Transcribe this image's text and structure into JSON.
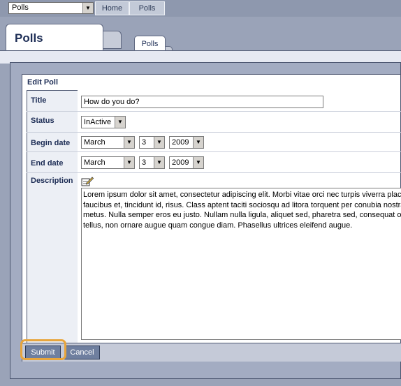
{
  "topnav": {
    "module_select": "Polls",
    "tabs": [
      "Home",
      "Polls"
    ]
  },
  "page": {
    "title": "Polls",
    "subtab": "Polls"
  },
  "form": {
    "panel_title": "Edit Poll",
    "labels": {
      "title": "Title",
      "status": "Status",
      "begin_date": "Begin date",
      "end_date": "End date",
      "description": "Description"
    },
    "title_value": "How do you do?",
    "status_value": "InActive",
    "begin_date": {
      "month": "March",
      "day": "3",
      "year": "2009"
    },
    "end_date": {
      "month": "March",
      "day": "3",
      "year": "2009"
    },
    "description_lines": [
      "Lorem ipsum dolor sit amet, consectetur adipiscing elit. Morbi vitae orci nec turpis viverra placerat",
      "faucibus et, tincidunt id, risus. Class aptent taciti sociosqu ad litora torquent per conubia nostra,",
      "metus. Nulla semper eros eu justo. Nullam nulla ligula, aliquet sed, pharetra sed, consequat ornare",
      "tellus, non ornare augue quam congue diam. Phasellus ultrices eleifend augue."
    ],
    "buttons": {
      "submit": "Submit",
      "cancel": "Cancel"
    }
  },
  "icons": {
    "module_dropdown": "chevron-down-icon",
    "description_edit": "pencil-edit-icon"
  },
  "colors": {
    "highlight": "#e8a53c",
    "button": "#6f7f9f",
    "label_text": "#1e2e56"
  }
}
